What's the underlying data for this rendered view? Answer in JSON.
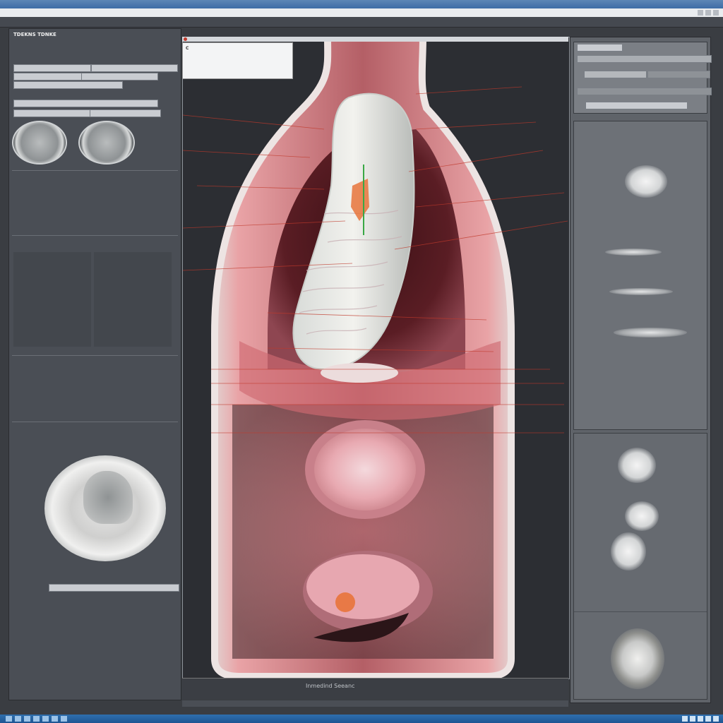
{
  "window": {
    "title": "",
    "toolbar_text": ""
  },
  "left_panel": {
    "header": "TDEKNS TDNKE",
    "patient_line": "",
    "fields": [],
    "table_rows": [],
    "section_labels": []
  },
  "viewer": {
    "header": "",
    "info_lines": [
      "C",
      "",
      "",
      ""
    ],
    "footer_caption": "Inmedind Seeanc"
  },
  "right_panel": {
    "headers": [],
    "captions": []
  },
  "colors": {
    "tissue_pink": "#d99a9a",
    "annotation_red": "#c0392b",
    "marker_orange": "#e8743b",
    "marker_green": "#39a845",
    "panel_bg": "#4a4e55",
    "taskbar": "#2f6fae"
  },
  "icons": [
    "window-controls",
    "close-icon",
    "marker-dot"
  ]
}
